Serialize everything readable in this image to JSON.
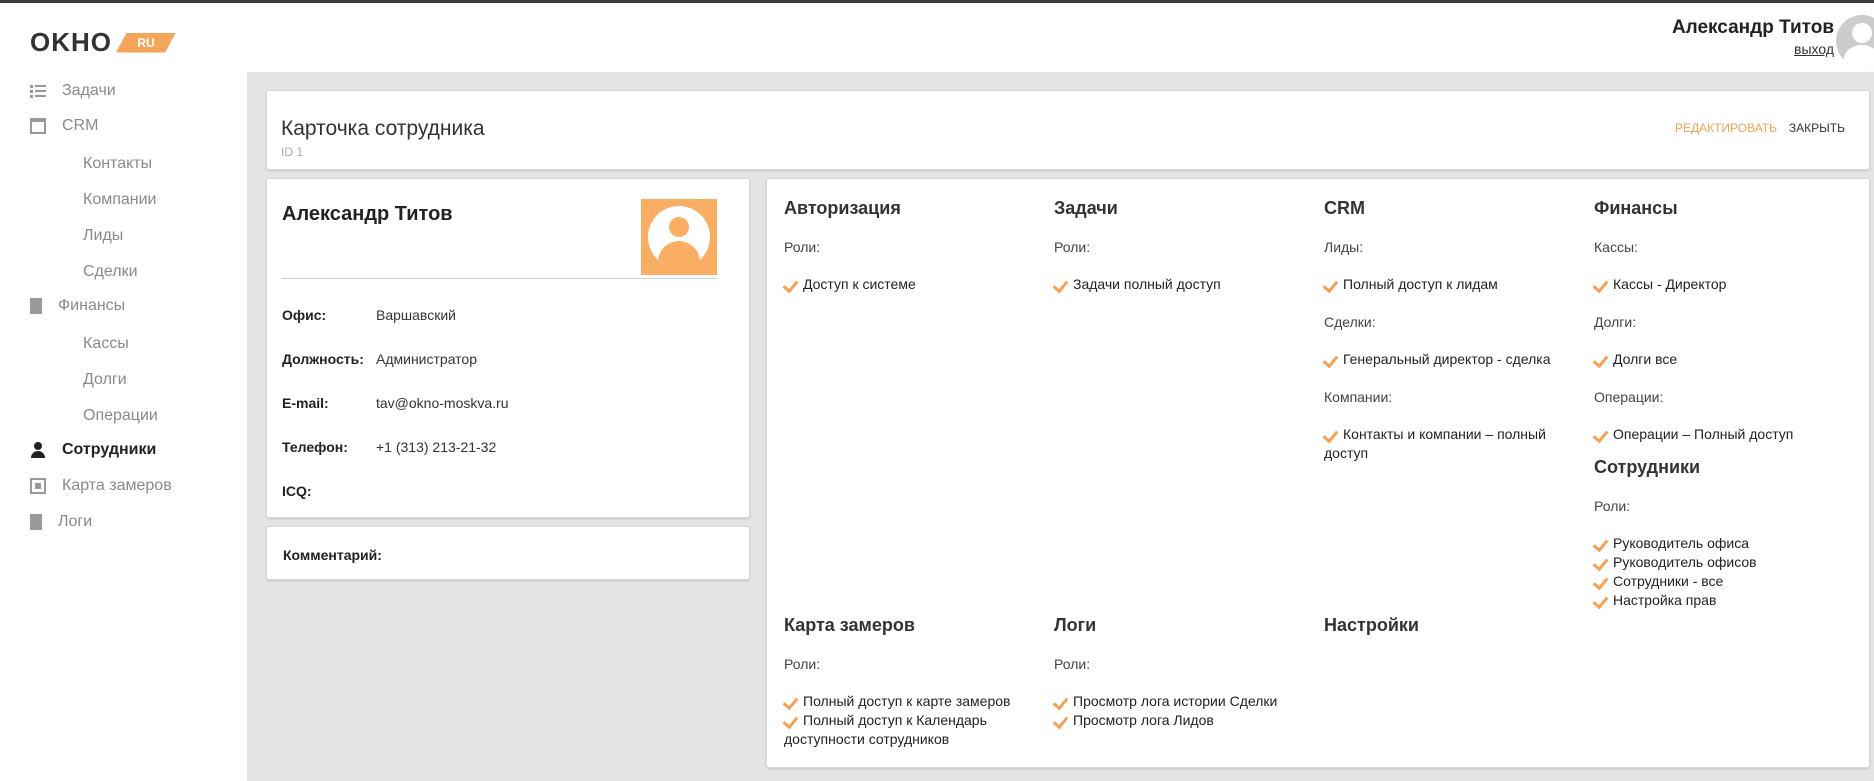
{
  "brand": {
    "logo_text": "OKHO",
    "logo_badge": "RU",
    "accent_color": "#f5a055"
  },
  "user": {
    "name": "Александр Титов",
    "logout": "выход"
  },
  "sidebar": {
    "items": [
      {
        "label": "Задачи",
        "icon": "tasks-icon"
      },
      {
        "label": "CRM",
        "icon": "window-icon",
        "children": [
          "Контакты",
          "Компании",
          "Лиды",
          "Сделки"
        ]
      },
      {
        "label": "Финансы",
        "icon": "document-icon",
        "children": [
          "Кассы",
          "Долги",
          "Операции"
        ]
      },
      {
        "label": "Сотрудники",
        "icon": "user-icon",
        "active": true
      },
      {
        "label": "Карта замеров",
        "icon": "map-icon"
      },
      {
        "label": "Логи",
        "icon": "log-icon"
      }
    ]
  },
  "header": {
    "title": "Карточка сотрудника",
    "id_text": "ID 1",
    "edit_label": "РЕДАКТИРОВАТЬ",
    "close_label": "ЗАКРЫТЬ"
  },
  "profile": {
    "name": "Александр Титов",
    "fields": [
      {
        "label": "Офис:",
        "value": "Варшавский"
      },
      {
        "label": "Должность:",
        "value": "Администратор"
      },
      {
        "label": "E-mail:",
        "value": "tav@okno-moskva.ru"
      },
      {
        "label": "Телефон:",
        "value": "+1 (313) 213-21-32"
      },
      {
        "label": "ICQ:",
        "value": ""
      }
    ]
  },
  "comment": {
    "label": "Комментарий:"
  },
  "permissions": {
    "auth": {
      "title": "Авторизация",
      "sub": "Роли:",
      "items": [
        "Доступ к системе"
      ]
    },
    "tasks": {
      "title": "Задачи",
      "sub": "Роли:",
      "items": [
        "Задачи полный доступ"
      ]
    },
    "crm": {
      "title": "CRM",
      "groups": [
        {
          "sub": "Лиды:",
          "items": [
            "Полный доступ к лидам"
          ]
        },
        {
          "sub": "Сделки:",
          "items": [
            "Генеральный директор - сделка"
          ]
        },
        {
          "sub": "Компании:",
          "items": [
            "Контакты и компании – полный",
            "доступ"
          ]
        }
      ]
    },
    "finance": {
      "title": "Финансы",
      "groups": [
        {
          "sub": "Кассы:",
          "items": [
            "Кассы - Директор"
          ]
        },
        {
          "sub": "Долги:",
          "items": [
            "Долги все"
          ]
        },
        {
          "sub": "Операции:",
          "items": [
            "Операции – Полный доступ"
          ]
        }
      ]
    },
    "staff": {
      "title": "Сотрудники",
      "sub": "Роли:",
      "items": [
        "Руководитель офиса",
        "Руководитель офисов",
        "Сотрудники - все",
        "Настройка прав"
      ]
    },
    "map": {
      "title": "Карта замеров",
      "sub": "Роли:",
      "items": [
        "Полный доступ к карте замеров",
        "Полный доступ к Календарь",
        "доступности сотрудников"
      ]
    },
    "logs": {
      "title": "Логи",
      "sub": "Роли:",
      "items": [
        "Просмотр лога истории Сделки",
        "Просмотр лога Лидов"
      ]
    },
    "settings": {
      "title": "Настройки"
    }
  }
}
